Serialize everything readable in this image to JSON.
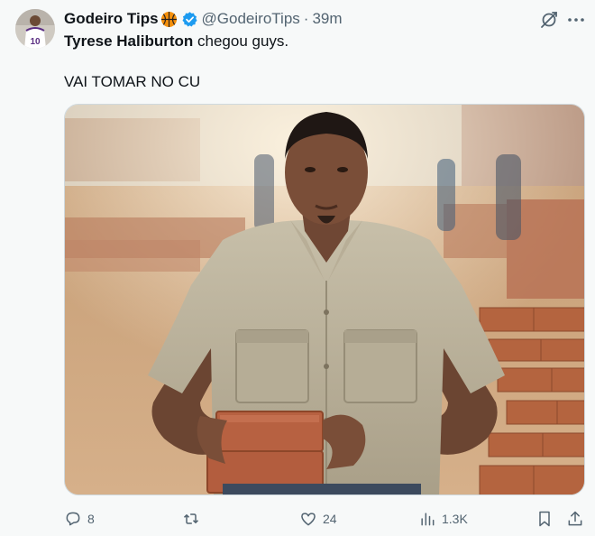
{
  "author": {
    "display_name": "Godeiro Tips",
    "handle": "@GodeiroTips",
    "separator": "·",
    "time": "39m",
    "avatar_jersey_number": "10"
  },
  "tweet": {
    "mention": "Tyrese Haliburton",
    "line1_rest": " chegou guys.",
    "line2": "VAI TOMAR NO CU"
  },
  "actions": {
    "replies": "8",
    "retweets": "",
    "likes": "24",
    "views": "1.3K"
  },
  "icons": {
    "reply": "reply-icon",
    "retweet": "retweet-icon",
    "like": "heart-icon",
    "views": "views-icon",
    "bookmark": "bookmark-icon",
    "share": "share-icon",
    "grok": "grok-icon",
    "more": "more-icon",
    "verified": "verified-badge-icon",
    "basketball": "basketball-emoji-icon"
  },
  "colors": {
    "text": "#0f1419",
    "secondary": "#536471",
    "verified": "#1d9bf0",
    "background": "#f7f9f9"
  }
}
